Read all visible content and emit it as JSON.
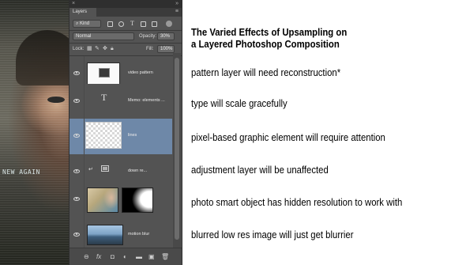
{
  "image": {
    "caption": "NEW AGAIN"
  },
  "panel": {
    "close_glyph": "×",
    "grip_glyph": "»",
    "tab_label": "Layers",
    "menu_glyph": "≡",
    "filter": {
      "kind_label": "Kind",
      "icons": [
        "image-filter-icon",
        "adjustment-filter-icon",
        "type-filter-icon",
        "shape-filter-icon",
        "smart-object-filter-icon"
      ]
    },
    "blend_mode": "Normal",
    "opacity_label": "Opacity:",
    "opacity_value": "30%",
    "lock_label": "Lock:",
    "fill_label": "Fill:",
    "fill_value": "100%",
    "layers": [
      {
        "name": "video pattern",
        "thumb": "white-with-dark-square",
        "selected": false
      },
      {
        "name": "Memo: elements ...",
        "thumb": "type-layer-T",
        "selected": false
      },
      {
        "name": "lines",
        "thumb": "transparent-checker",
        "selected": true
      },
      {
        "name": "down re...",
        "thumb": "adjustment-layer",
        "selected": false
      },
      {
        "name": "",
        "thumb": "photo-with-mask",
        "selected": false
      },
      {
        "name": "motion blur",
        "thumb": "blurred-landscape",
        "selected": false
      }
    ],
    "bottom_icons": [
      "link-layers-icon",
      "fx-icon",
      "add-mask-icon",
      "adjustment-icon",
      "group-folder-icon",
      "new-layer-icon",
      "trash-icon"
    ],
    "bottom_glyphs": {
      "link": "⊖",
      "fx": "fx",
      "mask": "◘",
      "adjust": "◐",
      "folder": "▬",
      "new": "▣",
      "trash": "🗑"
    }
  },
  "notes": {
    "title_line1": "The Varied Effects of Upsampling on",
    "title_line2": "a Layered Photoshop Composition",
    "items": [
      "pattern layer will need reconstruction*",
      "type will scale gracefully",
      "pixel-based graphic element will require attention",
      "adjustment layer will be unaffected",
      "photo smart object has hidden resolution to work with",
      "blurred low res image will just get blurrier"
    ]
  }
}
